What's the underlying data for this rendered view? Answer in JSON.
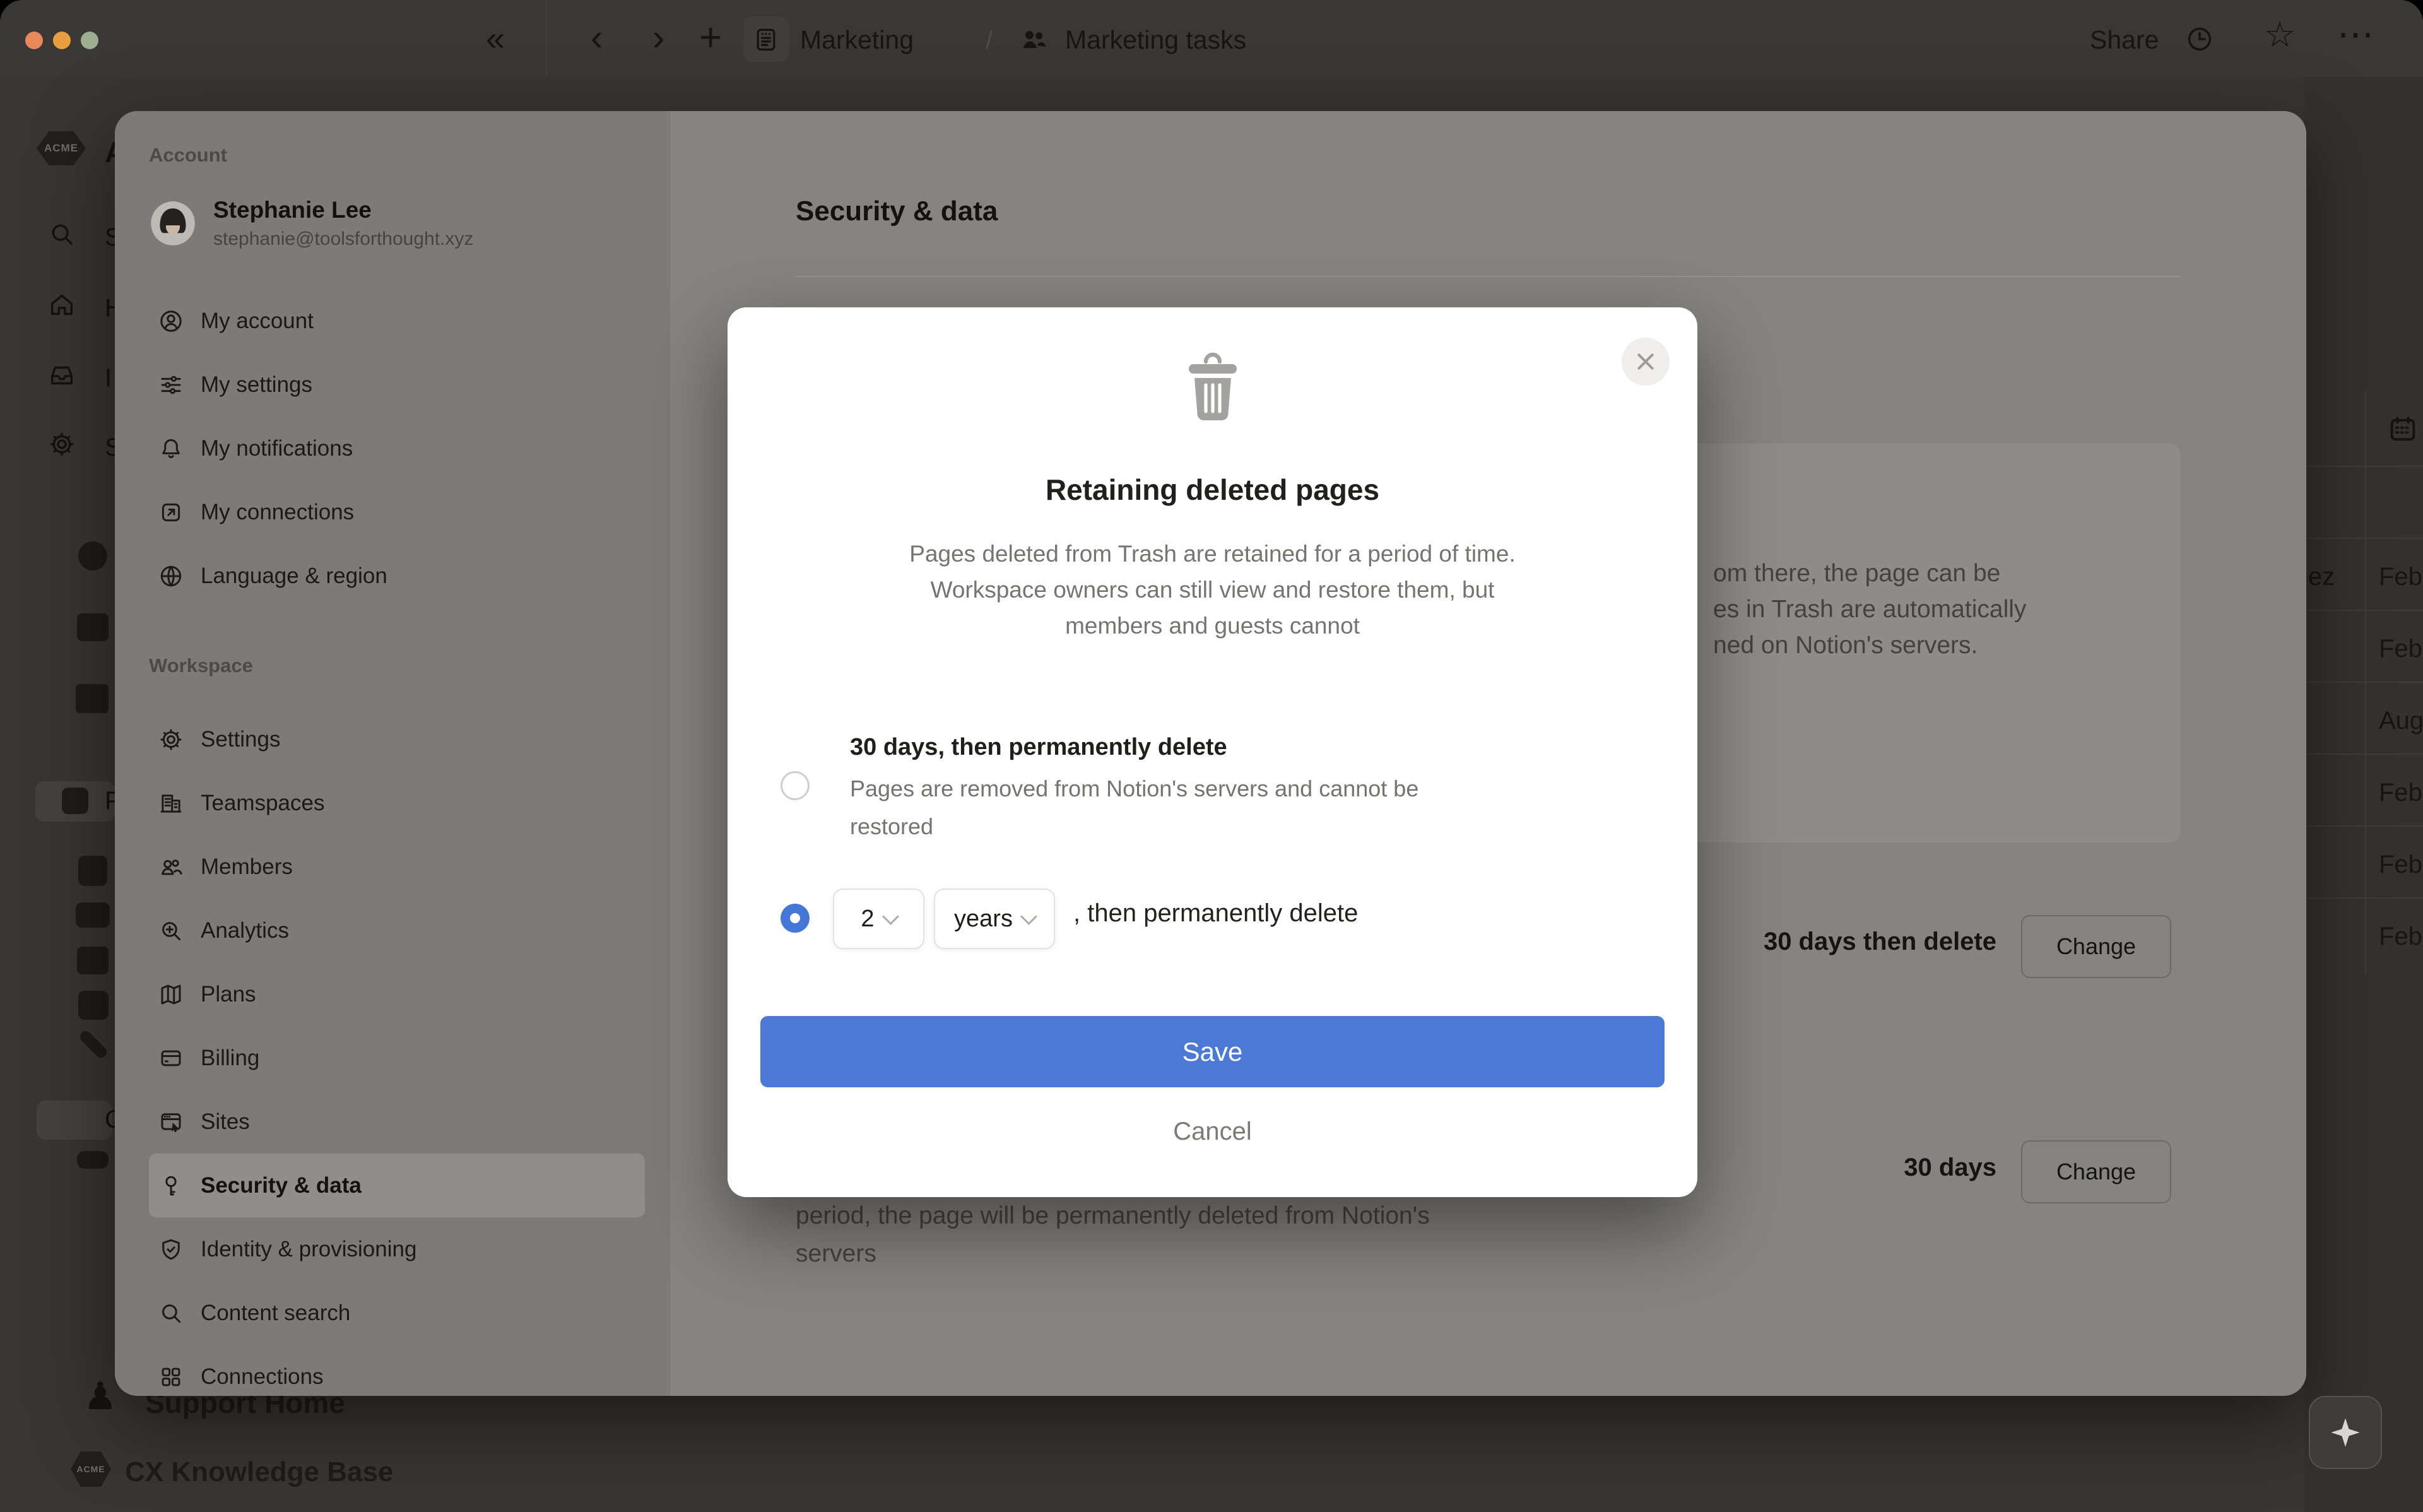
{
  "colors": {
    "accent_blue": "#4b79d5",
    "radio_blue": "#4577d9",
    "dialog_bg": "#ffffff",
    "selected_item_bg": "#8f8e8b",
    "traffic_red": "#e8875a",
    "traffic_yellow": "#e8a03f",
    "traffic_green": "#9bAF90"
  },
  "topbar": {
    "collapse_glyph": "«",
    "back_glyph": "‹",
    "forward_glyph": "›",
    "new_glyph": "+",
    "breadcrumb": {
      "page1": "Marketing",
      "separator": "/",
      "page2": "Marketing tasks"
    },
    "share_label": "Share",
    "star_glyph": "☆",
    "more_glyph": "⋯"
  },
  "behind": {
    "workspace_logo_text": "ACME",
    "workspace_letter": "A",
    "rail_letters": [
      "S",
      "H",
      "I",
      "S"
    ],
    "p_letter": "P",
    "c_letter": "C",
    "pawn_glyph": "♟",
    "support_home": "Support Home",
    "cx_knowledge_base": "CX Knowledge Base",
    "rail_icon_names": [
      "eight-ball-icon",
      "box-icon",
      "crate-icon",
      "plant-icon",
      "pot-plant-icon",
      "bridge-icon",
      "card-box-icon",
      "mailbox-icon",
      "screwdriver-icon",
      "people-emoji-icon",
      "cap-icon"
    ]
  },
  "table_strip": {
    "header_icon": "calendar-icon",
    "rows": [
      {
        "left": "ez",
        "right": "Feb"
      },
      {
        "left": "",
        "right": "Feb"
      },
      {
        "left": "",
        "right": "Aug"
      },
      {
        "left": "",
        "right": "Feb"
      },
      {
        "left": "",
        "right": "Feb"
      },
      {
        "left": "",
        "right": "Feb"
      }
    ]
  },
  "settings_sidebar": {
    "account_label": "Account",
    "profile": {
      "name": "Stephanie Lee",
      "email": "stephanie@toolsforthought.xyz"
    },
    "account_items": [
      {
        "icon": "person-circle-icon",
        "label": "My account"
      },
      {
        "icon": "sliders-icon",
        "label": "My settings"
      },
      {
        "icon": "bell-icon",
        "label": "My notifications"
      },
      {
        "icon": "arrow-box-icon",
        "label": "My connections"
      },
      {
        "icon": "globe-icon",
        "label": "Language & region"
      }
    ],
    "workspace_label": "Workspace",
    "workspace_items": [
      {
        "icon": "gear-icon",
        "label": "Settings"
      },
      {
        "icon": "building-icon",
        "label": "Teamspaces"
      },
      {
        "icon": "people-icon",
        "label": "Members"
      },
      {
        "icon": "analytics-icon",
        "label": "Analytics"
      },
      {
        "icon": "map-icon",
        "label": "Plans"
      },
      {
        "icon": "card-icon",
        "label": "Billing"
      },
      {
        "icon": "browser-icon",
        "label": "Sites"
      },
      {
        "icon": "key-icon",
        "label": "Security & data",
        "selected": true
      },
      {
        "icon": "shield-check-icon",
        "label": "Identity & provisioning"
      },
      {
        "icon": "search-icon",
        "label": "Content search"
      },
      {
        "icon": "grid-icon",
        "label": "Connections"
      }
    ]
  },
  "content": {
    "title": "Security & data",
    "info_fragments": [
      "om there, the page can be",
      "es in Trash are automatically",
      "ned on Notion's servers."
    ],
    "retention_row": {
      "value": "30 days then delete",
      "button_label": "Change"
    },
    "trash_row": {
      "value": "30 days",
      "button_label": "Change"
    },
    "below_dialog_lines": [
      "period, the page will be permanently deleted from Notion's",
      "servers"
    ]
  },
  "dialog": {
    "icon": "trash-icon",
    "title": "Retaining deleted pages",
    "description_lines": [
      "Pages deleted from Trash are retained for a period of time.",
      "Workspace owners can still view and restore them, but",
      "members and guests cannot"
    ],
    "option1": {
      "label": "30 days, then permanently delete",
      "desc_lines": [
        "Pages are removed from Notion's servers and cannot be",
        "restored"
      ],
      "selected": false
    },
    "option2": {
      "number_value": "2",
      "unit_value": "years",
      "suffix": ", then permanently delete",
      "selected": true
    },
    "save_label": "Save",
    "cancel_label": "Cancel"
  }
}
